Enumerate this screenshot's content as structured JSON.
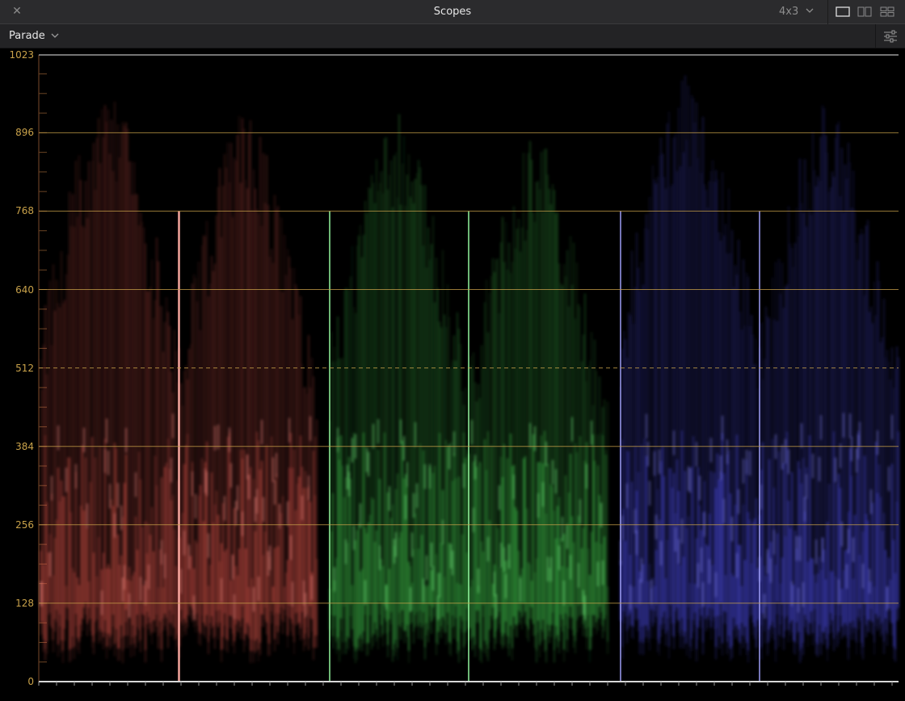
{
  "window": {
    "title": "Scopes",
    "close_icon": "close-icon",
    "aspect_label": "4x3",
    "layout_icons": [
      "single-view-icon",
      "dual-view-icon",
      "quad-view-icon"
    ]
  },
  "toolbar": {
    "mode_label": "Parade",
    "settings_icon": "sliders-icon"
  },
  "scope": {
    "type": "rgb-parade",
    "y_range": [
      0,
      1023
    ],
    "y_ticks": [
      "1023",
      "896",
      "768",
      "640",
      "512",
      "384",
      "256",
      "128",
      "0"
    ],
    "channels": [
      {
        "name": "red",
        "color": "#d9534a"
      },
      {
        "name": "green",
        "color": "#3fbf4a"
      },
      {
        "name": "blue",
        "color": "#4a4ae0"
      }
    ],
    "grid_color": "#c9a24a"
  }
}
